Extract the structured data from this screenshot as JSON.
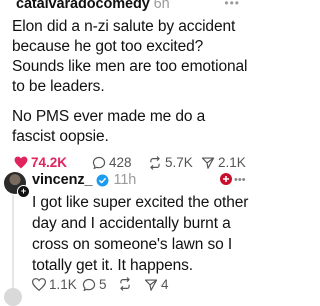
{
  "post1": {
    "username": "catalvaradocomedy",
    "time": "6h",
    "more": "•••",
    "lines": [
      "Elon did a n-zi salute by accident",
      "because he got too excited?",
      "Sounds like men are too emotional",
      "to be leaders.",
      "No PMS ever made me do a",
      "fascist oopsie."
    ],
    "likes": "74.2K",
    "comments": "428",
    "reposts": "5.7K",
    "shares": "2.1K"
  },
  "post2": {
    "username": "vincenz_",
    "time": "11h",
    "lines": [
      "I got like super excited the other",
      "day and I accidentally burnt a",
      "cross on someone's lawn so I",
      "totally get it. It happens."
    ],
    "likes": "1.1K",
    "comments": "5",
    "reposts": "",
    "shares": "4"
  },
  "colors": {
    "like_active": "#e0245e",
    "verified": "#1d9bf0",
    "muted": "#9b9b9b"
  },
  "icons": [
    "more-icon",
    "heart-icon",
    "comment-icon",
    "repost-icon",
    "share-icon",
    "verified-badge-icon",
    "sticker-icon",
    "plus-icon"
  ]
}
